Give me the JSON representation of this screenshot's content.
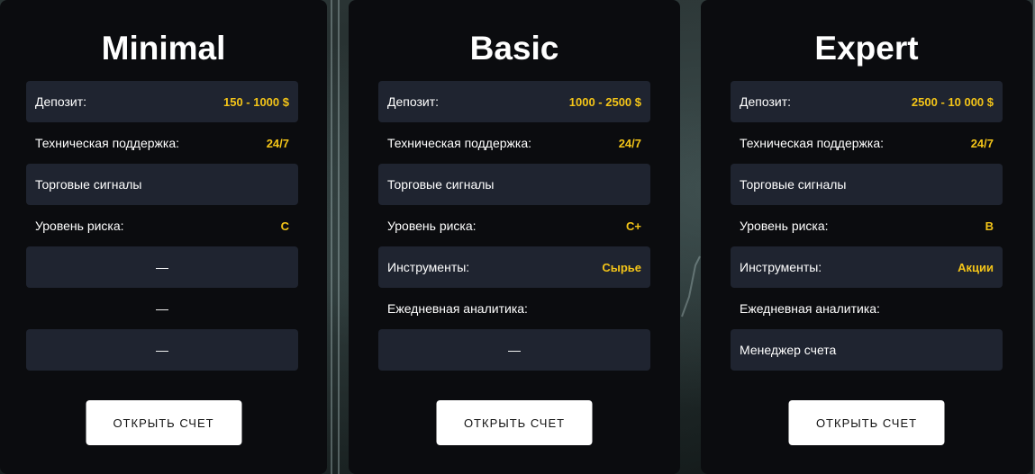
{
  "plans": [
    {
      "title": "Minimal",
      "rows": [
        {
          "label": "Депозит:",
          "value": "150 - 1000 $"
        },
        {
          "label": "Техническая поддержка:",
          "value": "24/7"
        },
        {
          "label": "Торговые сигналы",
          "value": ""
        },
        {
          "label": "Уровень риска:",
          "value": "C"
        },
        {
          "label": "—",
          "value": ""
        },
        {
          "label": "—",
          "value": ""
        },
        {
          "label": "—",
          "value": ""
        }
      ],
      "button": "ОТКРЫТЬ СЧЕТ"
    },
    {
      "title": "Basic",
      "rows": [
        {
          "label": "Депозит:",
          "value": "1000 - 2500 $"
        },
        {
          "label": "Техническая поддержка:",
          "value": "24/7"
        },
        {
          "label": "Торговые сигналы",
          "value": ""
        },
        {
          "label": "Уровень риска:",
          "value": "C+"
        },
        {
          "label": "Инструменты:",
          "value": "Сырье"
        },
        {
          "label": "Ежедневная аналитика:",
          "value": ""
        },
        {
          "label": "—",
          "value": ""
        }
      ],
      "button": "ОТКРЫТЬ СЧЕТ"
    },
    {
      "title": "Expert",
      "rows": [
        {
          "label": "Депозит:",
          "value": "2500 - 10 000 $"
        },
        {
          "label": "Техническая поддержка:",
          "value": "24/7"
        },
        {
          "label": "Торговые сигналы",
          "value": ""
        },
        {
          "label": "Уровень риска:",
          "value": "B"
        },
        {
          "label": "Инструменты:",
          "value": "Акции"
        },
        {
          "label": "Ежедневная аналитика:",
          "value": ""
        },
        {
          "label": "Менеджер счета",
          "value": ""
        }
      ],
      "button": "ОТКРЫТЬ СЧЕТ"
    }
  ],
  "colors": {
    "card_bg": "#0b0c0f",
    "row_shaded": "#1f2430",
    "accent_value": "#f3c418",
    "button_bg": "#ffffff"
  }
}
